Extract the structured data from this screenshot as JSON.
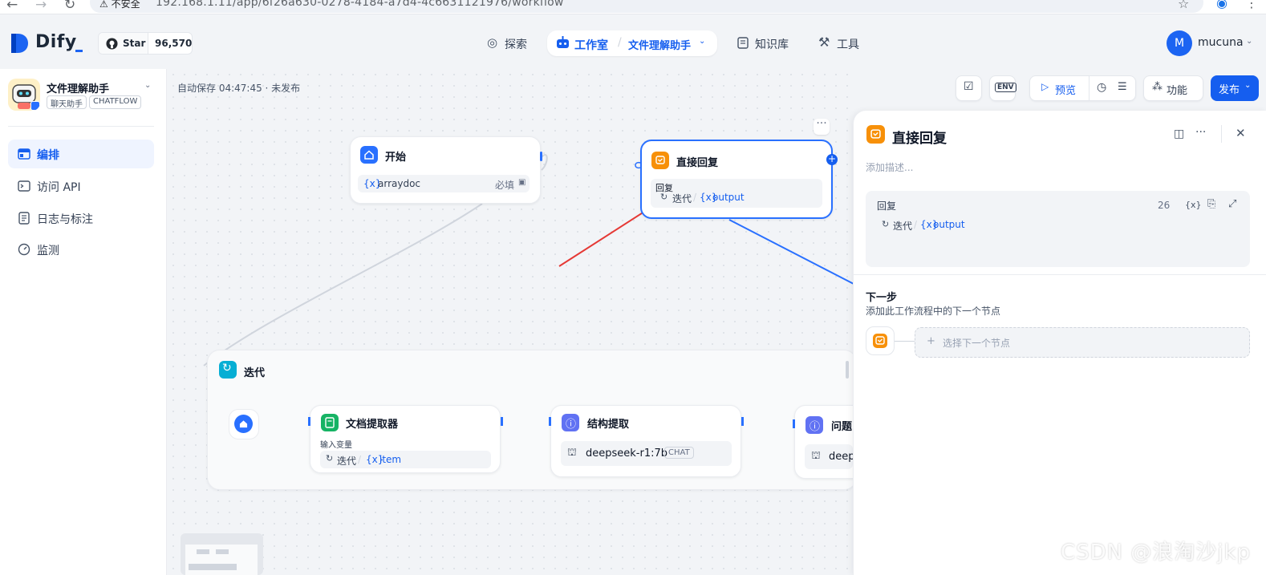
{
  "browser": {
    "insecure_label": "不安全",
    "url": "192.168.1.11/app/6f26a630-0278-4184-a7d4-4c6631121976/workflow"
  },
  "topnav": {
    "logo_text": "Dify",
    "star_label": "Star",
    "star_count": "96,570",
    "explore": "探索",
    "studio": "工作室",
    "studio_sep": "/",
    "app_switcher": "文件理解助手",
    "knowledge": "知识库",
    "tools": "工具",
    "avatar_initial": "M",
    "username": "mucuna"
  },
  "sidebar": {
    "app_name": "文件理解助手",
    "tags": [
      "聊天助手",
      "CHATFLOW"
    ],
    "items": [
      {
        "label": "编排",
        "icon": "layout-icon",
        "active": true
      },
      {
        "label": "访问 API",
        "icon": "terminal-icon",
        "active": false
      },
      {
        "label": "日志与标注",
        "icon": "file-list-icon",
        "active": false
      },
      {
        "label": "监测",
        "icon": "dashboard-icon",
        "active": false
      }
    ]
  },
  "canvas": {
    "autosave": "自动保存 04:47:45 · 未发布",
    "start_node": {
      "title": "开始",
      "var_prefix": "{x}",
      "var_name": "arraydoc",
      "required": "必填"
    },
    "answer_node": {
      "title": "直接回复",
      "reply_label": "回复",
      "var_source": "迭代",
      "var_prefix": "{x}",
      "var_name": "output"
    },
    "iteration_node": {
      "title": "迭代",
      "doc_extractor": {
        "title": "文档提取器",
        "input_label": "输入变量",
        "var_source": "迭代",
        "var_prefix": "{x}",
        "var_name": "item"
      },
      "struct_extract": {
        "title": "结构提取",
        "model": "deepseek-r1:7b",
        "badge": "CHAT"
      },
      "question": {
        "title": "问题",
        "model": "deep"
      }
    }
  },
  "toolbar": {
    "env_label": "ENV",
    "preview": "预览",
    "features": "功能",
    "publish": "发布"
  },
  "panel": {
    "title": "直接回复",
    "desc_placeholder": "添加描述...",
    "reply_label": "回复",
    "reply_count": "26",
    "reply_var_prefix": "{x}",
    "reply_var_source": "迭代",
    "reply_var_name": "output",
    "next_title": "下一步",
    "next_desc": "添加此工作流程中的下一个节点",
    "next_select": "选择下一个节点",
    "next_plus": "+"
  },
  "colors": {
    "primary": "#155EEF",
    "answer_orange": "#F79009",
    "start_blue": "#2970FF",
    "iteration_cyan": "#06AED4",
    "doc_green": "#16B364",
    "struct_indigo": "#6172F3",
    "annotation_red": "#E53935"
  },
  "watermark": "CSDN @浪淘沙jkp"
}
